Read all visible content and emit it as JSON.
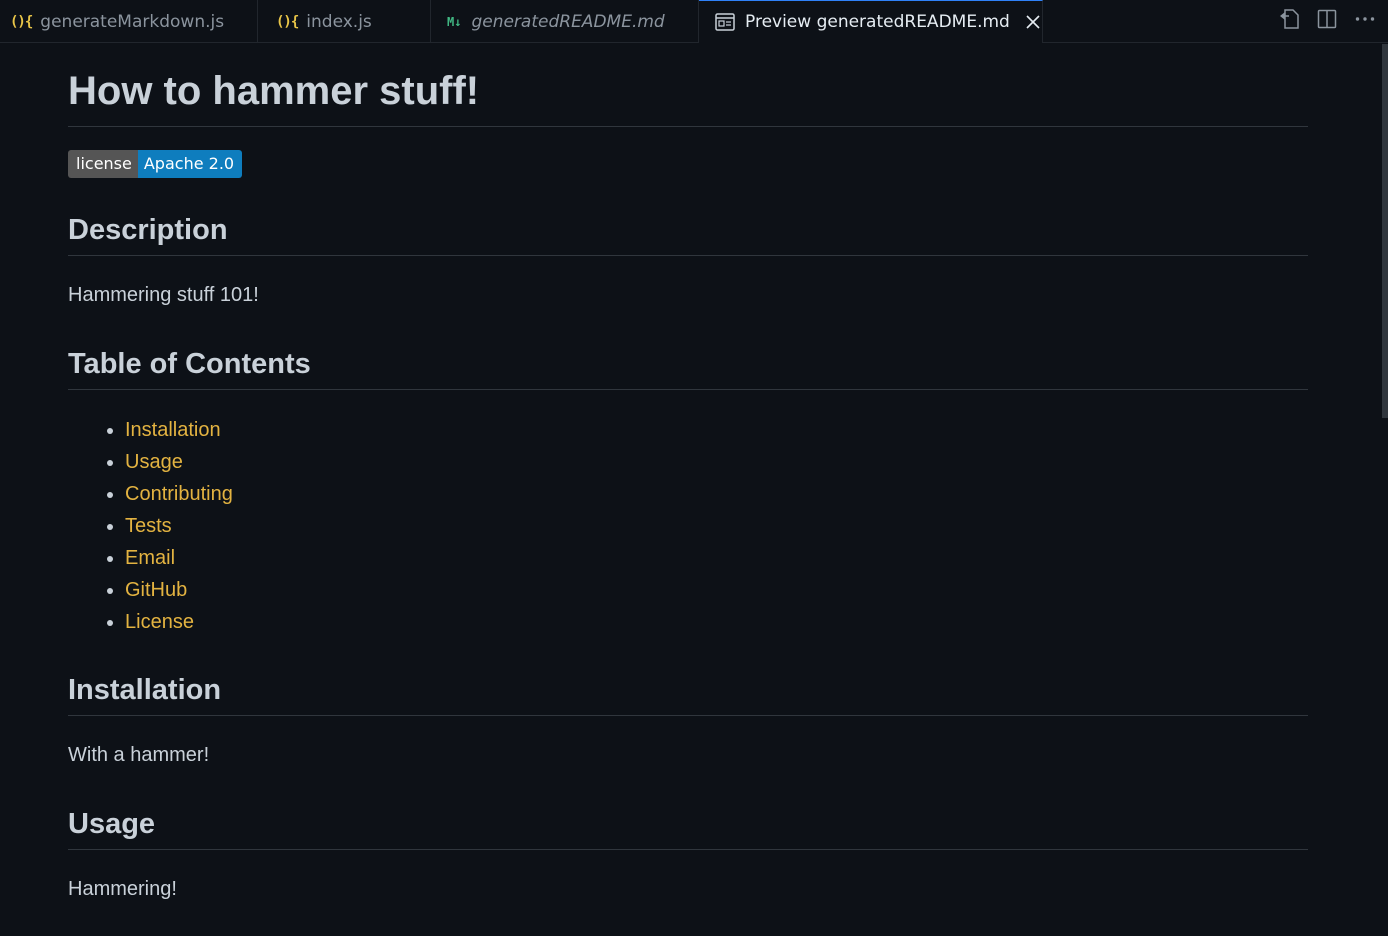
{
  "tabs": [
    {
      "label": "generateMarkdown.js",
      "icon": "js-icon"
    },
    {
      "label": "index.js",
      "icon": "js-icon"
    },
    {
      "label": "generatedREADME.md",
      "icon": "markdown-icon"
    },
    {
      "label": "Preview generatedREADME.md",
      "icon": "preview-icon"
    }
  ],
  "icons": {
    "js_glyph": "(){",
    "md_glyph": "M↓"
  },
  "doc": {
    "title": "How to hammer stuff!",
    "badge": {
      "left": "license",
      "right": "Apache 2.0"
    },
    "description_heading": "Description",
    "description_text": "Hammering stuff 101!",
    "toc_heading": "Table of Contents",
    "toc": [
      "Installation",
      "Usage",
      "Contributing",
      "Tests",
      "Email",
      "GitHub",
      "License"
    ],
    "installation_heading": "Installation",
    "installation_text": "With a hammer!",
    "usage_heading": "Usage",
    "usage_text": "Hammering!"
  },
  "colors": {
    "background": "#0d1117",
    "link": "#e3b341",
    "badge_left": "#555555",
    "badge_right": "#0e7dbe"
  }
}
